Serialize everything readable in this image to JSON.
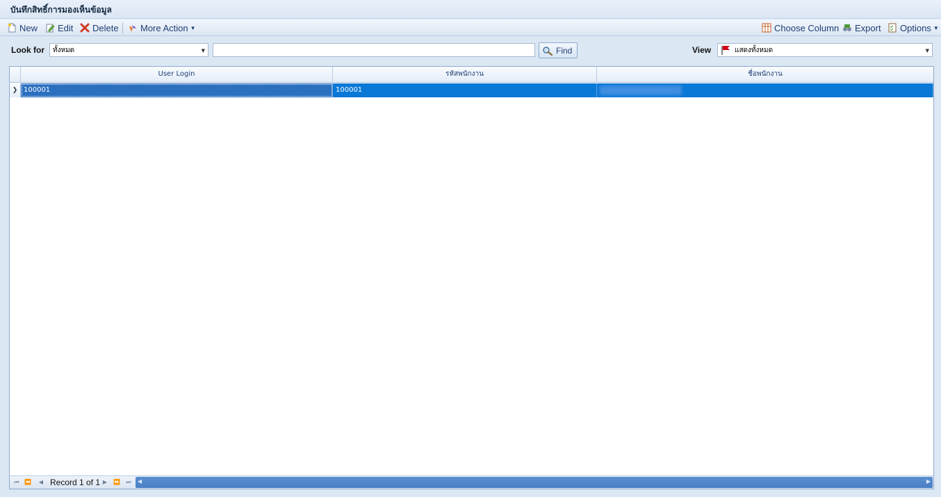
{
  "window": {
    "title": "บันทึกสิทธิ์การมองเห็นข้อมูล"
  },
  "toolbar": {
    "new_label": "New",
    "edit_label": "Edit",
    "delete_label": "Delete",
    "more_action_label": "More Action",
    "choose_column_label": "Choose Column",
    "export_label": "Export",
    "options_label": "Options"
  },
  "search": {
    "look_for_label": "Look for",
    "look_for_value": "ทั้งหมด",
    "keyword_value": "",
    "find_label": "Find",
    "view_label": "View",
    "view_value": "แสดงทั้งหมด"
  },
  "grid": {
    "columns": [
      "User Login",
      "รหัสพนักงาน",
      "ชื่อพนักงาน"
    ],
    "rows": [
      {
        "user_login": "100001",
        "employee_code": "100001",
        "employee_name": ""
      }
    ]
  },
  "navigator": {
    "record_text": "Record 1 of 1"
  },
  "colors": {
    "accent": "#0a78d6",
    "toolbar_text": "#1f3f74",
    "flag": "#d0021b"
  },
  "icons": [
    "new-icon",
    "edit-icon",
    "delete-icon",
    "more-action-icon",
    "choose-column-icon",
    "export-icon",
    "options-icon",
    "find-icon",
    "flag-icon"
  ]
}
